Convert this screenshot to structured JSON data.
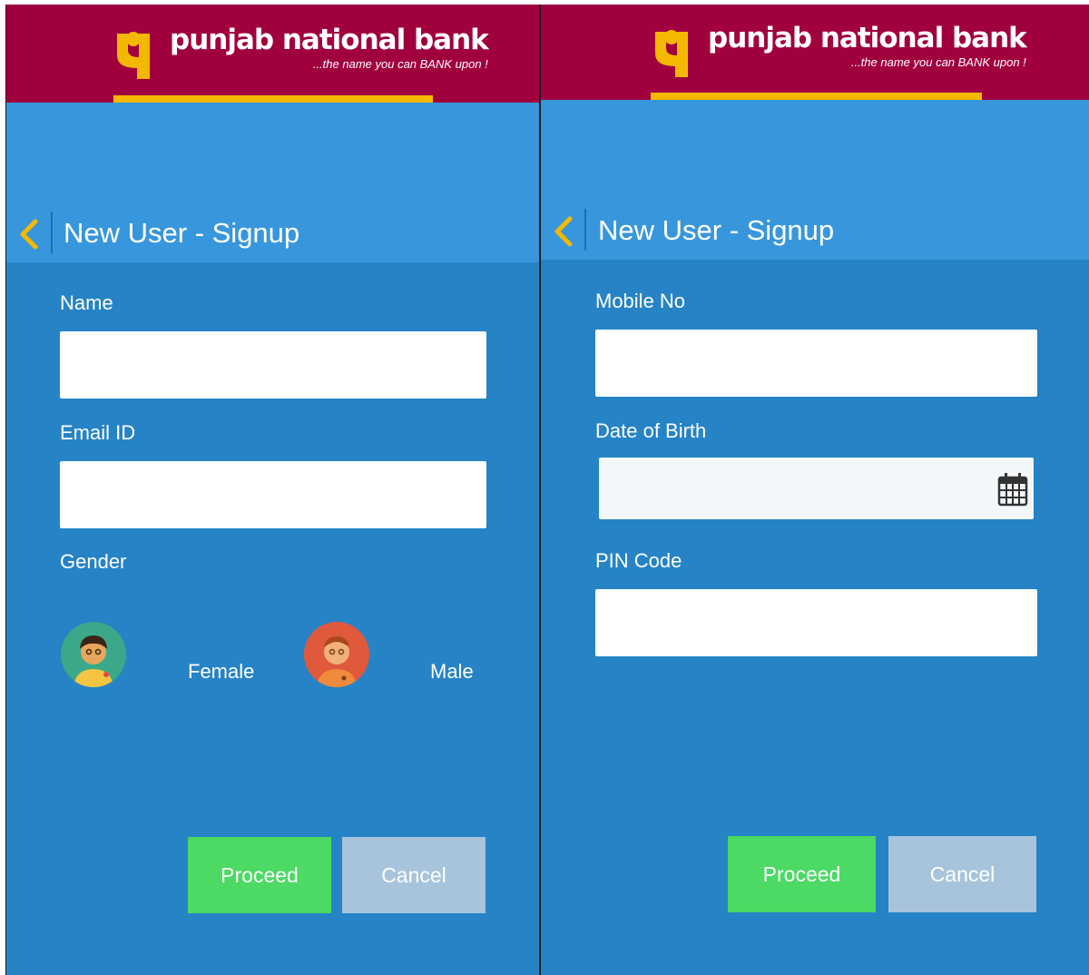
{
  "brand": {
    "name": "punjab national bank",
    "tagline": "...the name you can BANK upon !",
    "logo_icon": "pnb-logo-icon"
  },
  "colors": {
    "header": "#a1003f",
    "gold": "#f5b800",
    "titlebar": "#3897dc",
    "body": "#2683c6",
    "proceed": "#4cd964",
    "cancel": "#a7c4dc"
  },
  "screens": [
    {
      "title": "New User - Signup",
      "back_icon": "chevron-left-icon",
      "fields": [
        {
          "label": "Name",
          "value": ""
        },
        {
          "label": "Email ID",
          "value": ""
        }
      ],
      "gender": {
        "label": "Gender",
        "options": [
          {
            "label": "Female",
            "icon": "female-avatar-icon"
          },
          {
            "label": "Male",
            "icon": "male-avatar-icon"
          }
        ]
      },
      "buttons": {
        "proceed": "Proceed",
        "cancel": "Cancel"
      }
    },
    {
      "title": "New User - Signup",
      "back_icon": "chevron-left-icon",
      "fields": [
        {
          "label": "Mobile No",
          "value": ""
        },
        {
          "label": "Date of Birth",
          "value": "",
          "icon": "calendar-icon"
        },
        {
          "label": "PIN Code",
          "value": ""
        }
      ],
      "buttons": {
        "proceed": "Proceed",
        "cancel": "Cancel"
      }
    }
  ]
}
